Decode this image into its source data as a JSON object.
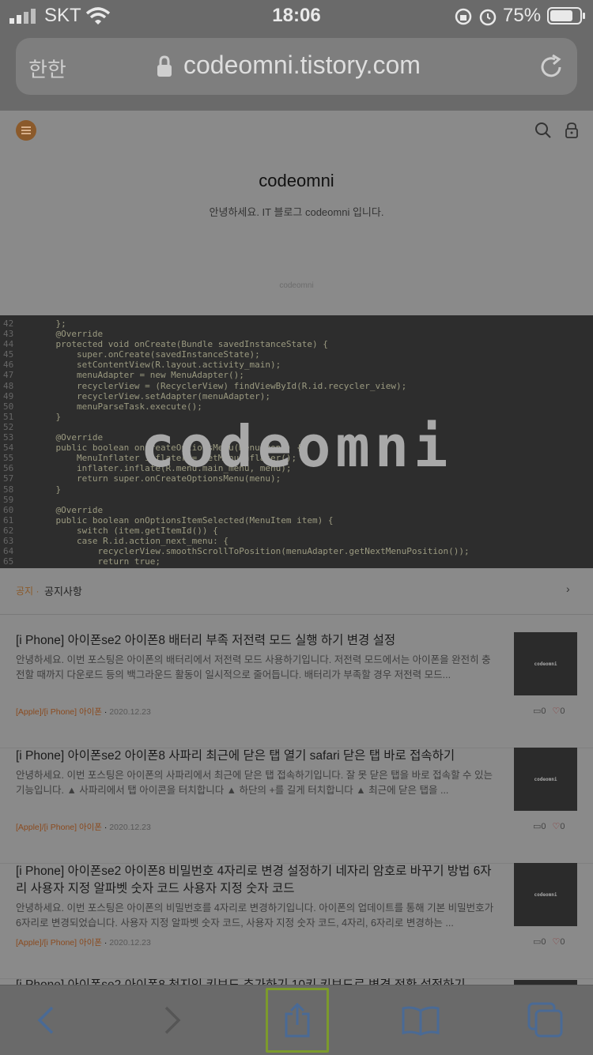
{
  "status_bar": {
    "carrier": "SKT",
    "time": "18:06",
    "battery": "75%"
  },
  "address_bar": {
    "text_size_label": "한한",
    "url": "codeomni.tistory.com"
  },
  "blog": {
    "title": "codeomni",
    "description": "안녕하세요. IT 블로그 codeomni 입니다.",
    "small_title": "codeomni",
    "banner_text": "codeomni"
  },
  "banner_code": [
    {
      "ln": "42",
      "code": "    };"
    },
    {
      "ln": "43",
      "code": "    @Override"
    },
    {
      "ln": "44",
      "code": "    protected void onCreate(Bundle savedInstanceState) {"
    },
    {
      "ln": "45",
      "code": "        super.onCreate(savedInstanceState);"
    },
    {
      "ln": "46",
      "code": "        setContentView(R.layout.activity_main);"
    },
    {
      "ln": "47",
      "code": "        menuAdapter = new MenuAdapter();"
    },
    {
      "ln": "48",
      "code": "        recyclerView = (RecyclerView) findViewById(R.id.recycler_view);"
    },
    {
      "ln": "49",
      "code": "        recyclerView.setAdapter(menuAdapter);"
    },
    {
      "ln": "50",
      "code": "        menuParseTask.execute();"
    },
    {
      "ln": "51",
      "code": "    }"
    },
    {
      "ln": "52",
      "code": ""
    },
    {
      "ln": "53",
      "code": "    @Override"
    },
    {
      "ln": "54",
      "code": "    public boolean onCreateOptionsMenu(Menu menu) {"
    },
    {
      "ln": "55",
      "code": "        MenuInflater inflater = getMenuInflater();"
    },
    {
      "ln": "56",
      "code": "        inflater.inflate(R.menu.main_menu, menu);"
    },
    {
      "ln": "57",
      "code": "        return super.onCreateOptionsMenu(menu);"
    },
    {
      "ln": "58",
      "code": "    }"
    },
    {
      "ln": "59",
      "code": ""
    },
    {
      "ln": "60",
      "code": "    @Override"
    },
    {
      "ln": "61",
      "code": "    public boolean onOptionsItemSelected(MenuItem item) {"
    },
    {
      "ln": "62",
      "code": "        switch (item.getItemId()) {"
    },
    {
      "ln": "63",
      "code": "        case R.id.action_next_menu: {"
    },
    {
      "ln": "64",
      "code": "            recyclerView.smoothScrollToPosition(menuAdapter.getNextMenuPosition());"
    },
    {
      "ln": "65",
      "code": "            return true;"
    }
  ],
  "notice": {
    "category": "공지",
    "separator": "·",
    "text": "공지사항",
    "arrow": "›"
  },
  "posts": [
    {
      "title": "[i Phone] 아이폰se2 아이폰8 배터리 부족 저전력 모드 실행 하기 변경 설정",
      "excerpt": "안녕하세요. 이번 포스팅은 아이폰의 배터리에서 저전력 모드 사용하기입니다. 저전력 모드에서는 아이폰을 완전히 충전할 때까지 다운로드 등의 백그라운드 활동이 일시적으로 줄어듭니다. 배터리가 부족할 경우 저전력 모드...",
      "category": "[Apple]/[i Phone] 아이폰",
      "date": "2020.12.23",
      "comments": "0",
      "likes": "0",
      "thumb": "codeomni"
    },
    {
      "title": "[i Phone] 아이폰se2 아이폰8 사파리 최근에 닫은 탭 열기 safari 닫은 탭 바로 접속하기",
      "excerpt": "안녕하세요. 이번 포스팅은 아이폰의 사파리에서 최근에 닫은 탭 접속하기입니다. 잘 못 닫은 탭을 바로 접속할 수 있는 기능입니다. ▲ 사파리에서 탭 아이콘을 터치합니다 ▲ 하단의 +를 길게 터치합니다 ▲ 최근에 닫은 탭을 ...",
      "category": "[Apple]/[i Phone] 아이폰",
      "date": "2020.12.23",
      "comments": "0",
      "likes": "0",
      "thumb": "codeomni"
    },
    {
      "title": "[i Phone] 아이폰se2 아이폰8 비밀번호 4자리로 변경 설정하기 네자리 암호로 바꾸기 방법 6자리 사용자 지정 알파벳 숫자 코드 사용자 지정 숫자 코드",
      "excerpt": "안녕하세요. 이번 포스팅은 아이폰의 비밀번호를 4자리로 변경하기입니다. 아이폰의 업데이트를 통해 기본 비밀번호가 6자리로 변경되었습니다. 사용자 지정 알파벳 숫자 코드, 사용자 지정 숫자 코드, 4자리, 6자리로 변경하는 ...",
      "category": "[Apple]/[i Phone] 아이폰",
      "date": "2020.12.23",
      "comments": "0",
      "likes": "0",
      "thumb": "codeomni"
    },
    {
      "title": "[i Phone] 아이폰se2 아이폰8 천지인 키보드 추가하기 10키 키보드로 변경 전환 설정하기",
      "excerpt": "",
      "category": "",
      "date": "",
      "comments": "",
      "likes": "",
      "thumb": ""
    }
  ],
  "colors": {
    "accent_orange": "#8b5a2b",
    "share_highlight": "#7c9a2c",
    "toolbar_blue": "#4a6a95"
  },
  "icons": {
    "menu": "menu-icon",
    "search": "search-icon",
    "lock": "lock-icon",
    "reload": "reload-icon",
    "back": "back-arrow-icon",
    "forward": "forward-arrow-icon",
    "share": "share-icon",
    "bookmarks": "bookmarks-icon",
    "tabs": "tabs-icon"
  }
}
